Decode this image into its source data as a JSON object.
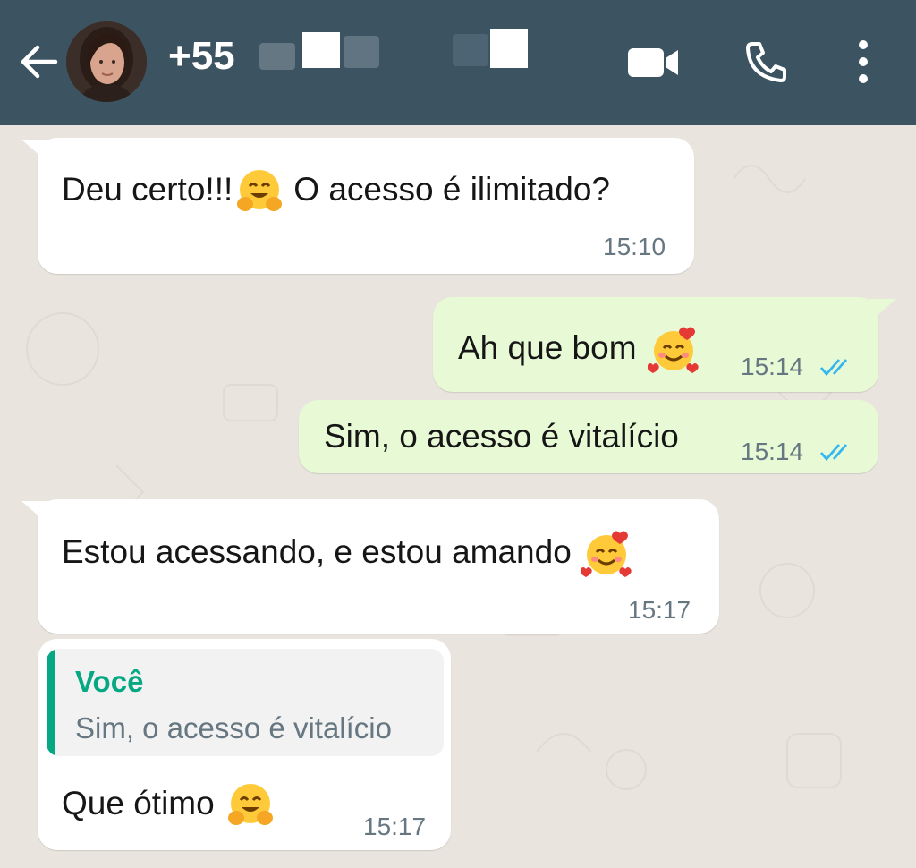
{
  "header": {
    "phone_prefix": "+55",
    "back_icon": "arrow-left-icon",
    "icons": [
      "video-call-icon",
      "phone-call-icon",
      "more-vertical-icon"
    ],
    "color": "#3c5361"
  },
  "messages": [
    {
      "direction": "in",
      "text": "Deu certo!!!",
      "emoji": "hugging-face",
      "text_after": "O acesso é ilimitado?",
      "time": "15:10"
    },
    {
      "direction": "out",
      "text": "Ah que bom",
      "emoji": "smiling-face-with-hearts",
      "time": "15:14",
      "status": "read"
    },
    {
      "direction": "out",
      "text": "Sim, o acesso é vitalício",
      "time": "15:14",
      "status": "read"
    },
    {
      "direction": "in",
      "text": "Estou acessando, e estou amando",
      "emoji": "smiling-face-with-hearts",
      "time": "15:17"
    },
    {
      "direction": "in",
      "reply_to": {
        "author": "Você",
        "text": "Sim, o acesso é vitalício"
      },
      "text": "Que ótimo",
      "emoji": "hugging-face",
      "time": "15:17"
    }
  ],
  "colors": {
    "incoming_bubble": "#ffffff",
    "outgoing_bubble": "#e7fad5",
    "read_ticks": "#34b7f1",
    "quote_accent": "#06a884",
    "wallpaper": "#e9e4de"
  }
}
